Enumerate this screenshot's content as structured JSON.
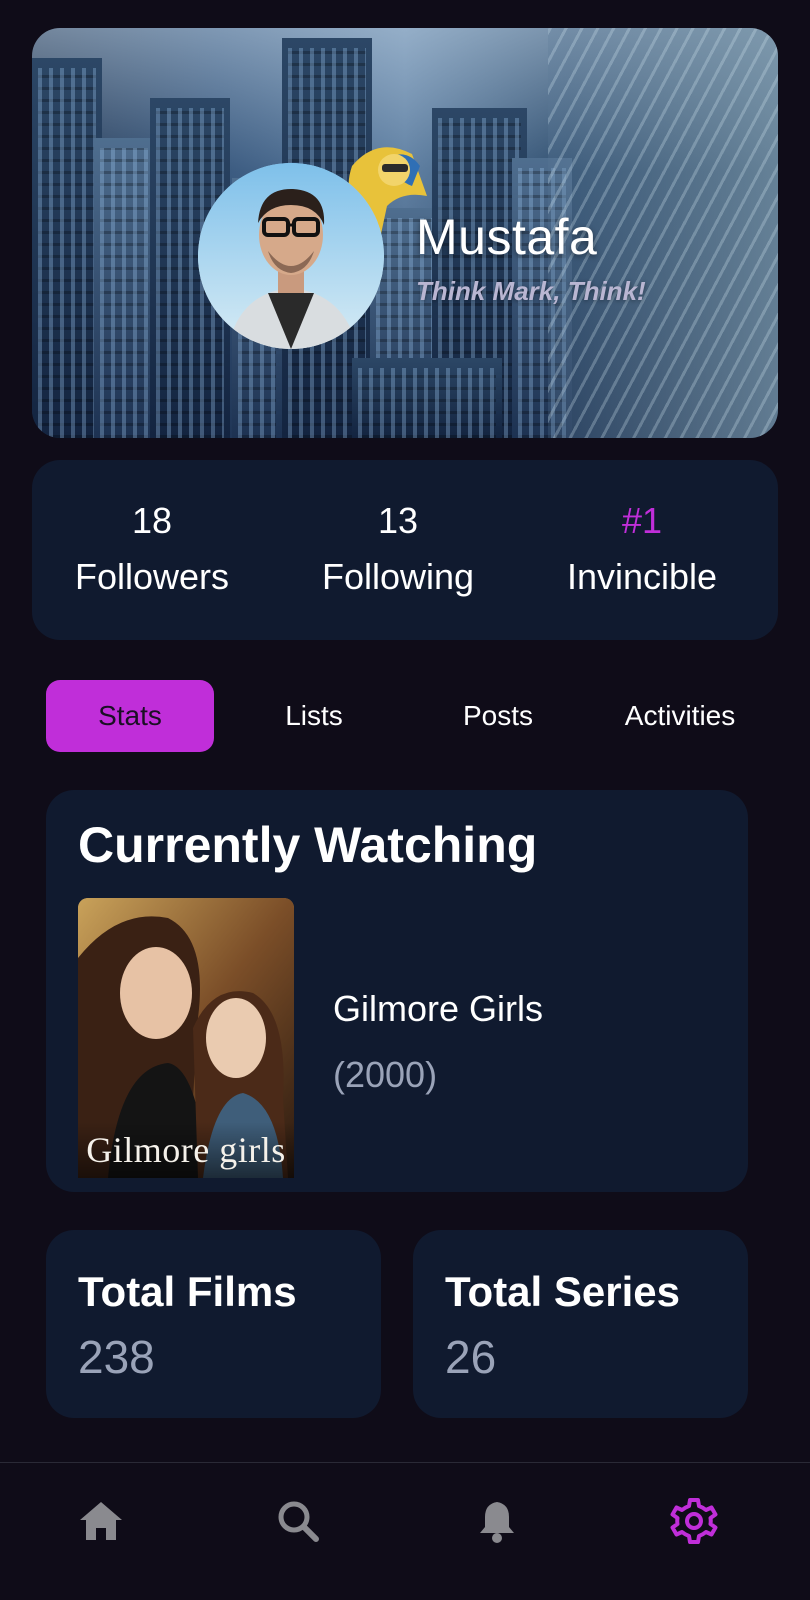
{
  "profile": {
    "name": "Mustafa",
    "tagline": "Think Mark, Think!"
  },
  "counts": [
    {
      "value": "18",
      "label": "Followers",
      "accent": false
    },
    {
      "value": "13",
      "label": "Following",
      "accent": false
    },
    {
      "value": "#1",
      "label": "Invincible",
      "accent": true
    }
  ],
  "tabs": [
    {
      "label": "Stats",
      "active": true
    },
    {
      "label": "Lists",
      "active": false
    },
    {
      "label": "Posts",
      "active": false
    },
    {
      "label": "Activities",
      "active": false
    }
  ],
  "watching": {
    "heading": "Currently Watching",
    "show_title": "Gilmore Girls",
    "show_year": "(2000)",
    "poster_text": "Gilmore girls"
  },
  "totals": {
    "films_label": "Total Films",
    "films_value": "238",
    "series_label": "Total Series",
    "series_value": "26"
  },
  "nav": [
    {
      "icon": "home-icon",
      "active": false
    },
    {
      "icon": "search-icon",
      "active": false
    },
    {
      "icon": "bell-icon",
      "active": false
    },
    {
      "icon": "gear-icon",
      "active": true
    }
  ],
  "colors": {
    "accent": "#c02ed9",
    "background": "#0f0c18",
    "card": "#101a2f",
    "muted_text": "#9aa3b8",
    "nav_inactive": "#8a8a8f"
  }
}
